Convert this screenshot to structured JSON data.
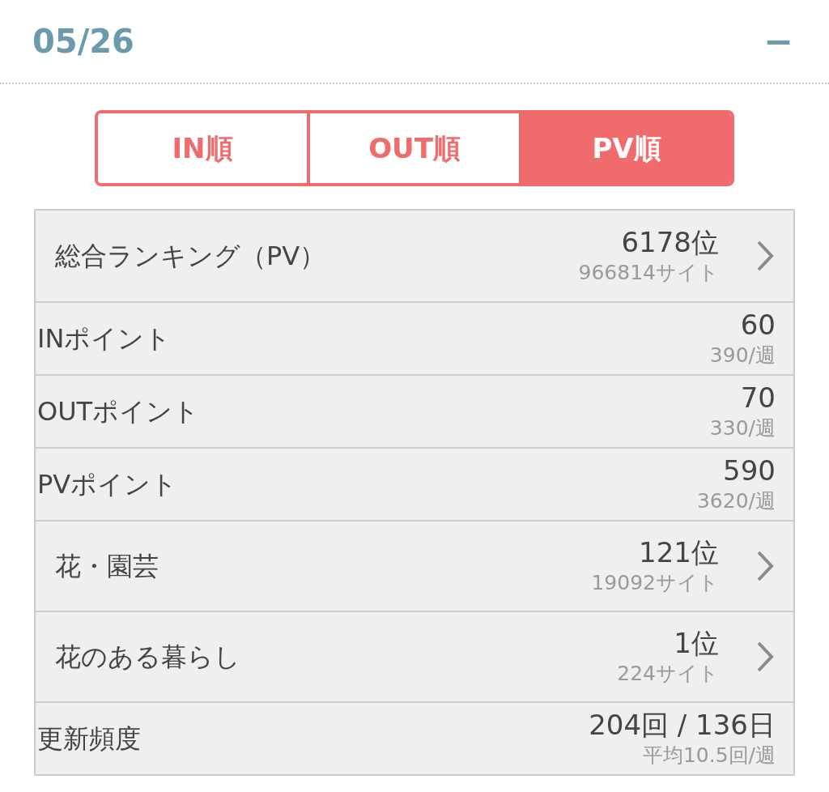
{
  "header": {
    "date": "05/26",
    "collapse_icon": "−"
  },
  "tabs": [
    {
      "label": "IN順",
      "selected": false
    },
    {
      "label": "OUT順",
      "selected": false
    },
    {
      "label": "PV順",
      "selected": true
    }
  ],
  "rows": [
    {
      "kind": "link",
      "label": "総合ランキング（PV）",
      "value": "6178位",
      "sub": "966814サイト"
    },
    {
      "kind": "point",
      "label": "INポイント",
      "value": "60",
      "sub": "390/週"
    },
    {
      "kind": "point",
      "label": "OUTポイント",
      "value": "70",
      "sub": "330/週"
    },
    {
      "kind": "point",
      "label": "PVポイント",
      "value": "590",
      "sub": "3620/週"
    },
    {
      "kind": "link",
      "label": "花・園芸",
      "value": "121位",
      "sub": "19092サイト"
    },
    {
      "kind": "link",
      "label": "花のある暮らし",
      "value": "1位",
      "sub": "224サイト"
    },
    {
      "kind": "point",
      "label": "更新頻度",
      "value": "204回 / 136日",
      "sub": "平均10.5回/週"
    }
  ]
}
